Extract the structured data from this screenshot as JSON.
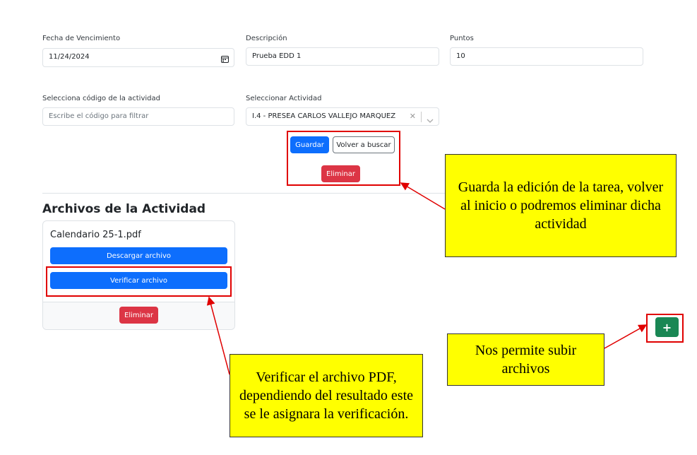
{
  "form": {
    "due_date": {
      "label": "Fecha de Vencimiento",
      "value": "11/24/2024"
    },
    "description": {
      "label": "Descripción",
      "value": "Prueba EDD 1"
    },
    "points": {
      "label": "Puntos",
      "value": "10"
    },
    "activity_code": {
      "label": "Selecciona código de la actividad",
      "placeholder": "Escribe el código para filtrar"
    },
    "activity_select": {
      "label": "Seleccionar Actividad",
      "value": "I.4 - PRESEA CARLOS VALLEJO MARQUEZ"
    }
  },
  "actions": {
    "save_label": "Guardar",
    "back_label": "Volver a buscar",
    "delete_label": "Eliminar"
  },
  "files": {
    "section_title": "Archivos de la Actividad",
    "items": [
      {
        "name": "Calendario 25-1.pdf",
        "download_label": "Descargar archivo",
        "verify_label": "Verificar archivo",
        "delete_label": "Eliminar"
      }
    ]
  },
  "fab": {
    "label": "+"
  },
  "annotations": {
    "actions_note": "Guarda la edición de la tarea, volver al inicio o podremos eliminar dicha actividad",
    "verify_note": "Verificar el archivo PDF, dependiendo del resultado este se le asignara la verificación.",
    "upload_note": "Nos permite subir archivos"
  },
  "colors": {
    "primary": "#0d6efd",
    "danger": "#dc3545",
    "success": "#198754",
    "highlight": "#ffff00",
    "annotation_border": "#e00000"
  },
  "icons": {
    "calendar": "calendar-icon",
    "clear": "clear-icon",
    "chevron": "chevron-down-icon"
  }
}
